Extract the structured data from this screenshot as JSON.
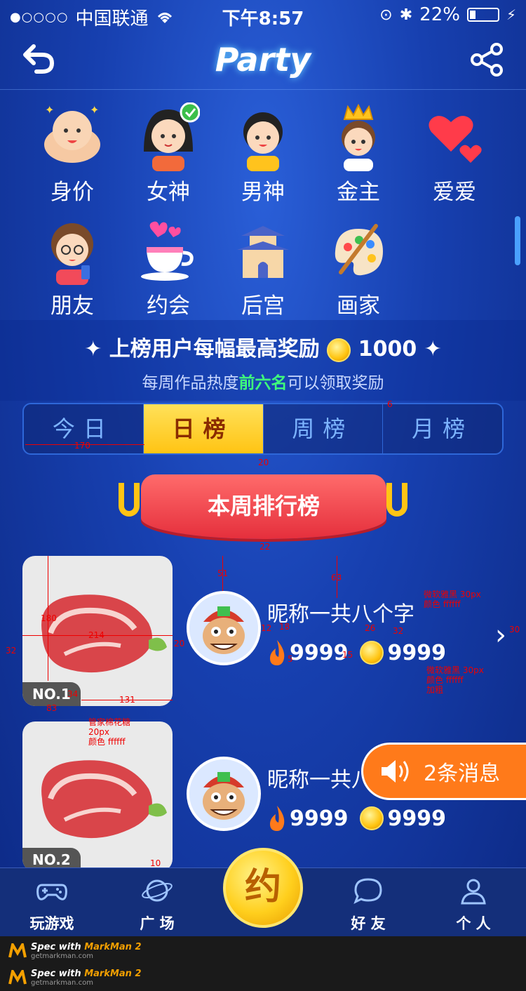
{
  "status": {
    "carrier": "中国联通",
    "time": "下午8:57",
    "battery": "22%"
  },
  "header": {
    "title": "Party"
  },
  "categories": [
    {
      "label": "身价",
      "icon": "muscle-baby-icon"
    },
    {
      "label": "女神",
      "icon": "girl-icon"
    },
    {
      "label": "男神",
      "icon": "boy-icon"
    },
    {
      "label": "金主",
      "icon": "crown-boy-icon"
    },
    {
      "label": "爱爱",
      "icon": "hearts-icon"
    },
    {
      "label": "朋友",
      "icon": "friend-icon"
    },
    {
      "label": "约会",
      "icon": "cup-icon"
    },
    {
      "label": "后宫",
      "icon": "palace-icon"
    },
    {
      "label": "画家",
      "icon": "palette-icon"
    }
  ],
  "reward": {
    "line1_prefix": "上榜用户每幅最高奖励",
    "line1_amount": "1000",
    "line2_prefix": "每周作品热度",
    "line2_highlight": "前六名",
    "line2_suffix": "可以领取奖励"
  },
  "tabs": [
    "今日",
    "日榜",
    "周榜",
    "月榜"
  ],
  "ribbon": {
    "label": "本周排行榜"
  },
  "rows": [
    {
      "rank": "NO.1",
      "nick": "昵称一共八个字",
      "heat": "9999",
      "coins": "9999"
    },
    {
      "rank": "NO.2",
      "nick": "昵称一共八",
      "heat": "9999",
      "coins": "9999"
    }
  ],
  "toast": {
    "label": "2条消息"
  },
  "tabbar": {
    "play": "玩游戏",
    "plaza": "广 场",
    "center": "约",
    "friends": "好 友",
    "me": "个 人"
  },
  "annotations": {
    "a170": "170",
    "a6": "6",
    "a20top": "20",
    "a22": "22",
    "a51": "51",
    "a63": "63",
    "a180": "180",
    "a214": "214",
    "a32": "32",
    "a20": "20",
    "a12": "12",
    "a18": "18",
    "a26": "26",
    "a32b": "32",
    "a5": "5",
    "a15": "15",
    "a30": "30",
    "a34": "34",
    "a83": "83",
    "a131": "131",
    "a10": "10",
    "font1": "微软雅黑 30px",
    "color1": "颜色 ffffff",
    "font2": "微软雅黑 30px",
    "color2": "颜色 ffffff",
    "bold2": "加粗",
    "font3": "管家棉花糖",
    "size3": "20px",
    "color3": "颜色 ffffff"
  },
  "footer": {
    "spec": "Spec with",
    "brand": "MarkMan 2",
    "url": "getmarkman.com"
  }
}
